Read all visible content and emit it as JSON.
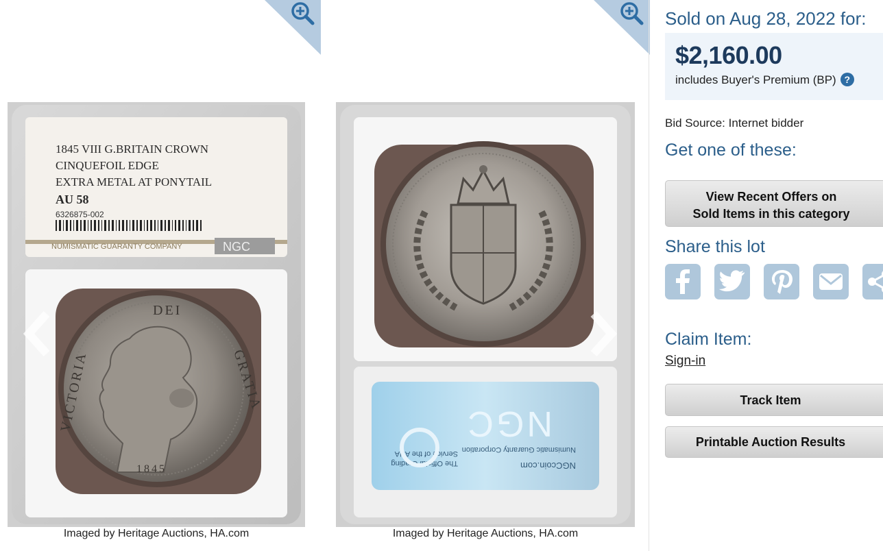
{
  "images": {
    "front": {
      "caption": "Imaged by Heritage Auctions, HA.com",
      "label_lines": [
        "1845 VIII G.BRITAIN CROWN",
        "CINQUEFOIL EDGE",
        "EXTRA METAL AT PONYTAIL"
      ],
      "grade": "AU 58",
      "cert": "6326875-002",
      "company": "NUMISMATIC GUARANTY COMPANY",
      "logo": "NGC",
      "legend_left": "VICTORIA",
      "legend_top": "DEI",
      "legend_right": "GRATIA",
      "date": "1845"
    },
    "back": {
      "caption": "Imaged by Heritage Auctions, HA.com",
      "hologram_lines": [
        "NGCcoin.com",
        "Numismatic Guaranty Corporation",
        "The Official Grading",
        "Service of the ANA"
      ],
      "logo": "NGC"
    }
  },
  "sale": {
    "sold_on": "Sold on Aug 28, 2022 for:",
    "price": "$2,160.00",
    "bp_text": "includes Buyer's Premium (BP)",
    "help": "?",
    "bid_source": "Bid Source: Internet bidder"
  },
  "get_one": {
    "heading": "Get one of these:",
    "btn_line1": "View Recent Offers on",
    "btn_line2": "Sold Items in this category"
  },
  "share": {
    "heading": "Share this lot",
    "icons": [
      "facebook-icon",
      "twitter-icon",
      "pinterest-icon",
      "email-icon",
      "share-icon"
    ]
  },
  "claim": {
    "heading": "Claim Item:",
    "signin": "Sign-in"
  },
  "actions": {
    "track": "Track Item",
    "print": "Printable Auction Results"
  },
  "colors": {
    "accent": "#2b5e8a",
    "price": "#1d3a5c",
    "price_bg": "#eef4fa",
    "share_bg": "#afc7db",
    "zoom_tab": "#b5cbe0"
  }
}
